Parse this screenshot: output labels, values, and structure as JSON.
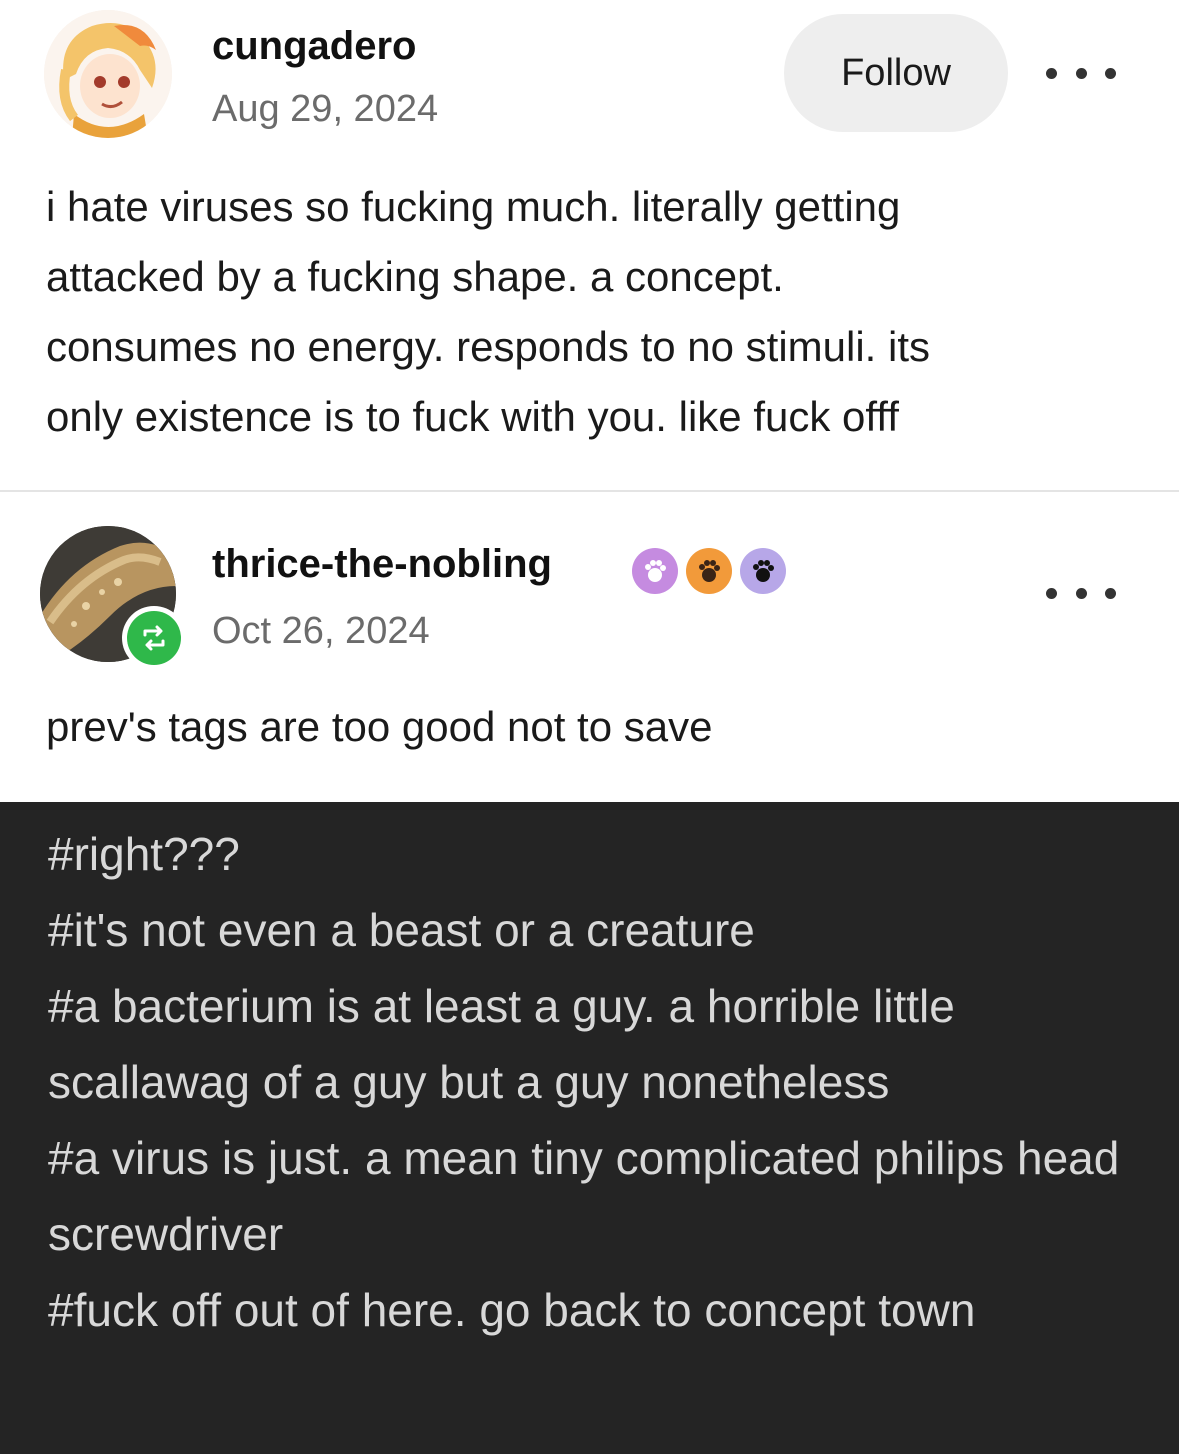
{
  "post1": {
    "username": "cungadero",
    "date": "Aug 29, 2024",
    "follow_label": "Follow",
    "avatar_icon": "anime-avatar-icon",
    "body_lines": [
      "i hate viruses so fucking much. literally getting",
      "attacked by a fucking shape. a concept.",
      "consumes no energy. responds to no stimuli. its",
      "only existence is to fuck with you. like fuck offf"
    ]
  },
  "post2": {
    "username": "thrice-the-nobling",
    "date": "Oct 26, 2024",
    "avatar_icon": "bread-photo-avatar-icon",
    "reblog_icon": "reblog-icon",
    "badge_icons": [
      "paw-badge-purple-icon",
      "paw-badge-orange-icon",
      "paw-badge-lavender-icon"
    ],
    "body": "prev's tags are too good not to save"
  },
  "tags": [
    "#right???",
    "#it's not even a beast or a creature",
    "#a bacterium is at least a guy. a horrible little scallawag of a guy but a guy nonetheless",
    "#a virus is just. a mean tiny complicated philips head screwdriver",
    "#fuck off out of here. go back to concept town"
  ],
  "colors": {
    "tag_background": "#242424",
    "tag_text": "#d8d8d8",
    "reblog_green": "#2fb84a",
    "date_gray": "#6b6b6b",
    "follow_bg": "#eeeeee"
  }
}
